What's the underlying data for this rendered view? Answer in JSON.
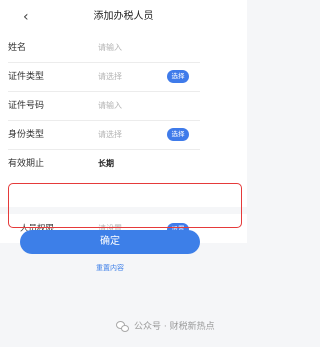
{
  "header": {
    "back_glyph": "‹",
    "title": "添加办税人员"
  },
  "form": {
    "rows": [
      {
        "label": "姓名",
        "value": "请输入",
        "filled": false
      },
      {
        "label": "证件类型",
        "value": "请选择",
        "filled": false,
        "action": "选择"
      },
      {
        "label": "证件号码",
        "value": "请输入",
        "filled": false
      },
      {
        "label": "身份类型",
        "value": "请选择",
        "filled": false,
        "action": "选择"
      },
      {
        "label": "有效期止",
        "value": "长期",
        "filled": true
      }
    ]
  },
  "permission": {
    "label": "人员权限",
    "value": "请设置",
    "action": "设置"
  },
  "buttons": {
    "confirm": "确定",
    "reset": "重置内容"
  },
  "watermark": {
    "text": "公众号 · 财税新热点"
  },
  "colors": {
    "accent": "#3d7fe8",
    "highlight": "#e53a3a"
  }
}
